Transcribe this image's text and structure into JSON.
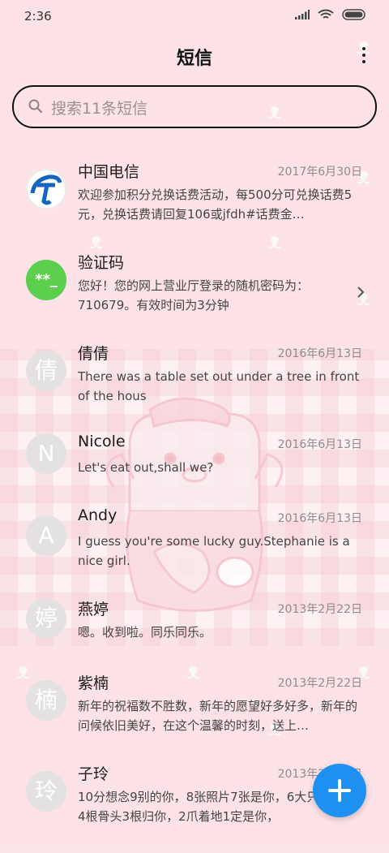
{
  "status": {
    "time": "2:36"
  },
  "header": {
    "title": "短信"
  },
  "search": {
    "placeholder": "搜索11条短信"
  },
  "messages": [
    {
      "name": "中国电信",
      "date": "2017年6月30日",
      "preview": "欢迎参加积分兑换话费活动，每500分可兑换话费5元，兑换话费请回复106或jfdh#话费金…",
      "avatar_type": "logo",
      "avatar_icon": "china-telecom-logo"
    },
    {
      "name": "验证码",
      "date": "",
      "preview": "您好！您的网上营业厅登录的随机密码为：710679。有效时间为3分钟",
      "avatar_text": "**_",
      "avatar_color": "#5ccf4f"
    },
    {
      "name": "倩倩",
      "date": "2016年6月13日",
      "preview": "There was a table set out under a tree in front of the hous",
      "avatar_text": "倩"
    },
    {
      "name": "Nicole",
      "date": "2016年6月13日",
      "preview": "Let's eat out,shall we?",
      "avatar_text": "N"
    },
    {
      "name": "Andy",
      "date": "2016年6月13日",
      "preview": "I guess you're some lucky guy.Stephanie is a nice girl.",
      "avatar_text": "A"
    },
    {
      "name": "燕婷",
      "date": "2013年2月22日",
      "preview": "嗯。收到啦。同乐同乐。",
      "avatar_text": "婷"
    },
    {
      "name": "紫楠",
      "date": "2013年2月22日",
      "preview": "新年的祝福数不胜数，新年的愿望好多好多，新年的问候依旧美好，在这个温馨的时刻，送上…",
      "avatar_text": "楠"
    },
    {
      "name": "子玲",
      "date": "2013年2月22日",
      "preview": "10分想念9别的你，8张照片7张是你，6大只像你，4根骨头3根归你，2爪着地1定是你，",
      "avatar_text": "玲"
    }
  ],
  "colors": {
    "accent": "#1e90f0",
    "background": "#fde3e8"
  }
}
